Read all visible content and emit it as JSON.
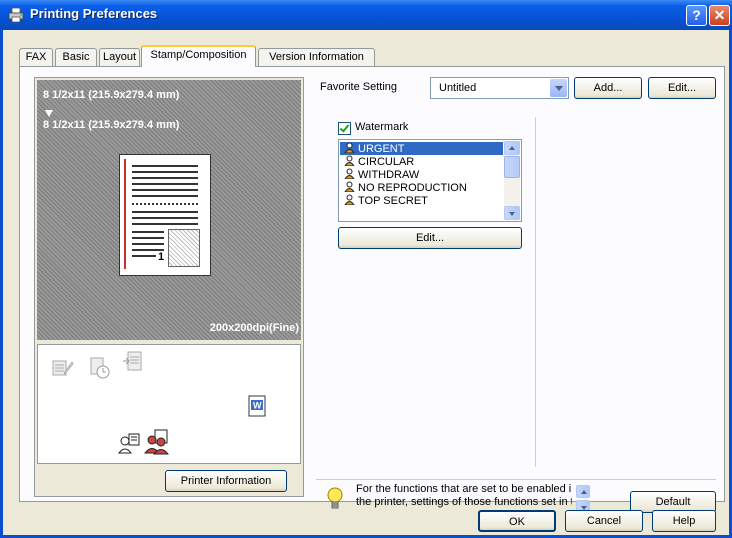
{
  "window": {
    "title": "Printing Preferences",
    "help_label": "?",
    "close_label": "✕"
  },
  "tabs": [
    {
      "label": "FAX"
    },
    {
      "label": "Basic"
    },
    {
      "label": "Layout"
    },
    {
      "label": "Stamp/Composition",
      "active": true
    },
    {
      "label": "Version Information"
    }
  ],
  "preview": {
    "original_size": "8 1/2x11 (215.9x279.4 mm)",
    "output_size": "8 1/2x11 (215.9x279.4 mm)",
    "resolution": "200x200dpi(Fine)",
    "page_number": "1"
  },
  "printer_info_button": "Printer Information",
  "favorite": {
    "label": "Favorite Setting",
    "value": "Untitled",
    "add_button": "Add...",
    "edit_button": "Edit..."
  },
  "watermark": {
    "checkbox_label": "Watermark",
    "checked": true,
    "items": [
      "URGENT",
      "CIRCULAR",
      "WITHDRAW",
      "NO REPRODUCTION",
      "TOP SECRET"
    ],
    "selected": "URGENT",
    "edit_button": "Edit..."
  },
  "tip": {
    "line1": "For the functions that are set to be enabled in",
    "line2": "the printer, settings of those functions set in the"
  },
  "buttons": {
    "default": "Default",
    "ok": "OK",
    "cancel": "Cancel",
    "help": "Help"
  },
  "colors": {
    "titlebar": "#0553d6",
    "dialog_bg": "#ece9d8",
    "selection": "#316ac5"
  },
  "icons": [
    "printer-icon",
    "help-icon",
    "close-icon",
    "checkmark-icon",
    "watermark-person-icon",
    "lightbulb-icon",
    "scroll-up-icon",
    "scroll-down-icon"
  ]
}
